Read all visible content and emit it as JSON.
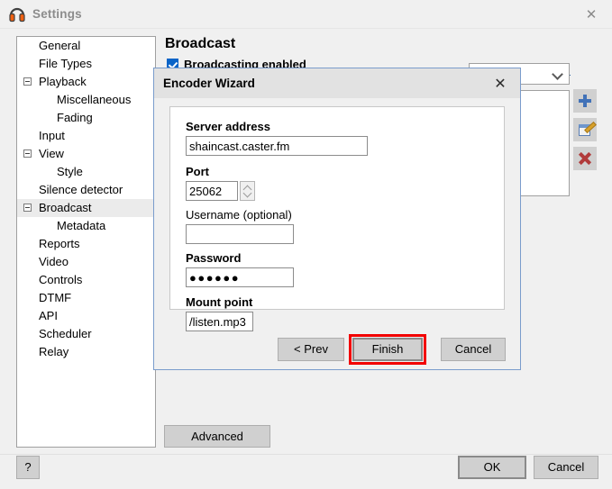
{
  "window": {
    "title": "Settings",
    "icon": "headphones-icon",
    "close_label": "✕"
  },
  "sidebar": {
    "items": [
      {
        "label": "General",
        "level": 1,
        "expander": false,
        "selected": false
      },
      {
        "label": "File Types",
        "level": 1,
        "expander": false,
        "selected": false
      },
      {
        "label": "Playback",
        "level": 1,
        "expander": true,
        "selected": false
      },
      {
        "label": "Miscellaneous",
        "level": 2,
        "expander": false,
        "selected": false
      },
      {
        "label": "Fading",
        "level": 2,
        "expander": false,
        "selected": false
      },
      {
        "label": "Input",
        "level": 1,
        "expander": false,
        "selected": false
      },
      {
        "label": "View",
        "level": 1,
        "expander": true,
        "selected": false
      },
      {
        "label": "Style",
        "level": 2,
        "expander": false,
        "selected": false
      },
      {
        "label": "Silence detector",
        "level": 1,
        "expander": false,
        "selected": false
      },
      {
        "label": "Broadcast",
        "level": 1,
        "expander": true,
        "selected": true
      },
      {
        "label": "Metadata",
        "level": 2,
        "expander": false,
        "selected": false
      },
      {
        "label": "Reports",
        "level": 1,
        "expander": false,
        "selected": false
      },
      {
        "label": "Video",
        "level": 1,
        "expander": false,
        "selected": false
      },
      {
        "label": "Controls",
        "level": 1,
        "expander": false,
        "selected": false
      },
      {
        "label": "DTMF",
        "level": 1,
        "expander": false,
        "selected": false
      },
      {
        "label": "API",
        "level": 1,
        "expander": false,
        "selected": false
      },
      {
        "label": "Scheduler",
        "level": 1,
        "expander": false,
        "selected": false
      },
      {
        "label": "Relay",
        "level": 1,
        "expander": false,
        "selected": false
      }
    ]
  },
  "main": {
    "heading": "Broadcast",
    "broadcasting_enabled_label": "Broadcasting enabled",
    "broadcasting_enabled_checked": true,
    "encoder_list": {
      "selected_value": "",
      "items": [
        "]"
      ]
    },
    "side_buttons": [
      {
        "name": "add-encoder-button",
        "icon": "plus-icon"
      },
      {
        "name": "edit-encoder-button",
        "icon": "edit-pencil-icon"
      },
      {
        "name": "delete-encoder-button",
        "icon": "red-x-icon"
      }
    ],
    "advanced_label": "Advanced"
  },
  "wizard": {
    "title": "Encoder Wizard",
    "close_label": "✕",
    "fields": [
      {
        "label": "Server address",
        "bold": true,
        "value": "shaincast.caster.fm",
        "placeholder": ""
      },
      {
        "label": "Port",
        "bold": true,
        "value": "25062",
        "placeholder": ""
      },
      {
        "label": "Username (optional)",
        "bold": false,
        "value": "",
        "placeholder": ""
      },
      {
        "label": "Password",
        "bold": true,
        "value": "●●●●●●",
        "placeholder": ""
      },
      {
        "label": "Mount point",
        "bold": true,
        "value": "/listen.mp3",
        "placeholder": ""
      }
    ],
    "buttons": {
      "prev": "< Prev",
      "finish": "Finish",
      "cancel": "Cancel"
    },
    "highlighted_button": "Finish",
    "highlight_color": "#f20000"
  },
  "footer": {
    "help_label": "?",
    "ok_label": "OK",
    "cancel_label": "Cancel"
  }
}
